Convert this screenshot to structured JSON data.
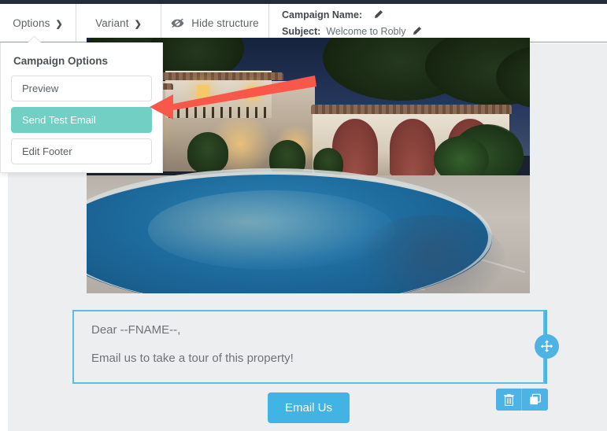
{
  "toolbar": {
    "options_label": "Options",
    "variant_label": "Variant",
    "hide_structure_label": "Hide structure",
    "hide_structure_icon": "eye-slash-icon",
    "campaign_name_label": "Campaign Name:",
    "campaign_name_value": "",
    "campaign_name_edit_icon": "pencil-icon",
    "subject_label": "Subject:",
    "subject_value": "Welcome to Robly",
    "subject_edit_icon": "pencil-icon"
  },
  "dropdown": {
    "title": "Campaign Options",
    "items": [
      {
        "label": "Preview",
        "active": false
      },
      {
        "label": "Send Test Email",
        "active": true
      },
      {
        "label": "Edit Footer",
        "active": false
      }
    ]
  },
  "editor": {
    "image_block_alt": "Spanish villa with swimming pool at dusk",
    "text_lines": [
      "Dear --FNAME--,",
      "Email us to take a tour of this property!"
    ],
    "cta_label": "Email Us",
    "move_handle_icon": "move-arrows-icon",
    "block_toolbar": [
      {
        "icon": "trash-icon",
        "name": "delete-block-button"
      },
      {
        "icon": "duplicate-icon",
        "name": "duplicate-block-button"
      }
    ]
  },
  "annotation": {
    "arrow_color": "#f9574a",
    "points_to": "Send Test Email"
  },
  "colors": {
    "accent_teal": "#72cfc4",
    "accent_blue": "#4cb3e4",
    "cta_blue": "#42b3e5",
    "canvas_gray": "#edeef0",
    "topbar_dark": "#222d38",
    "selection_blue": "#5bbce4"
  }
}
